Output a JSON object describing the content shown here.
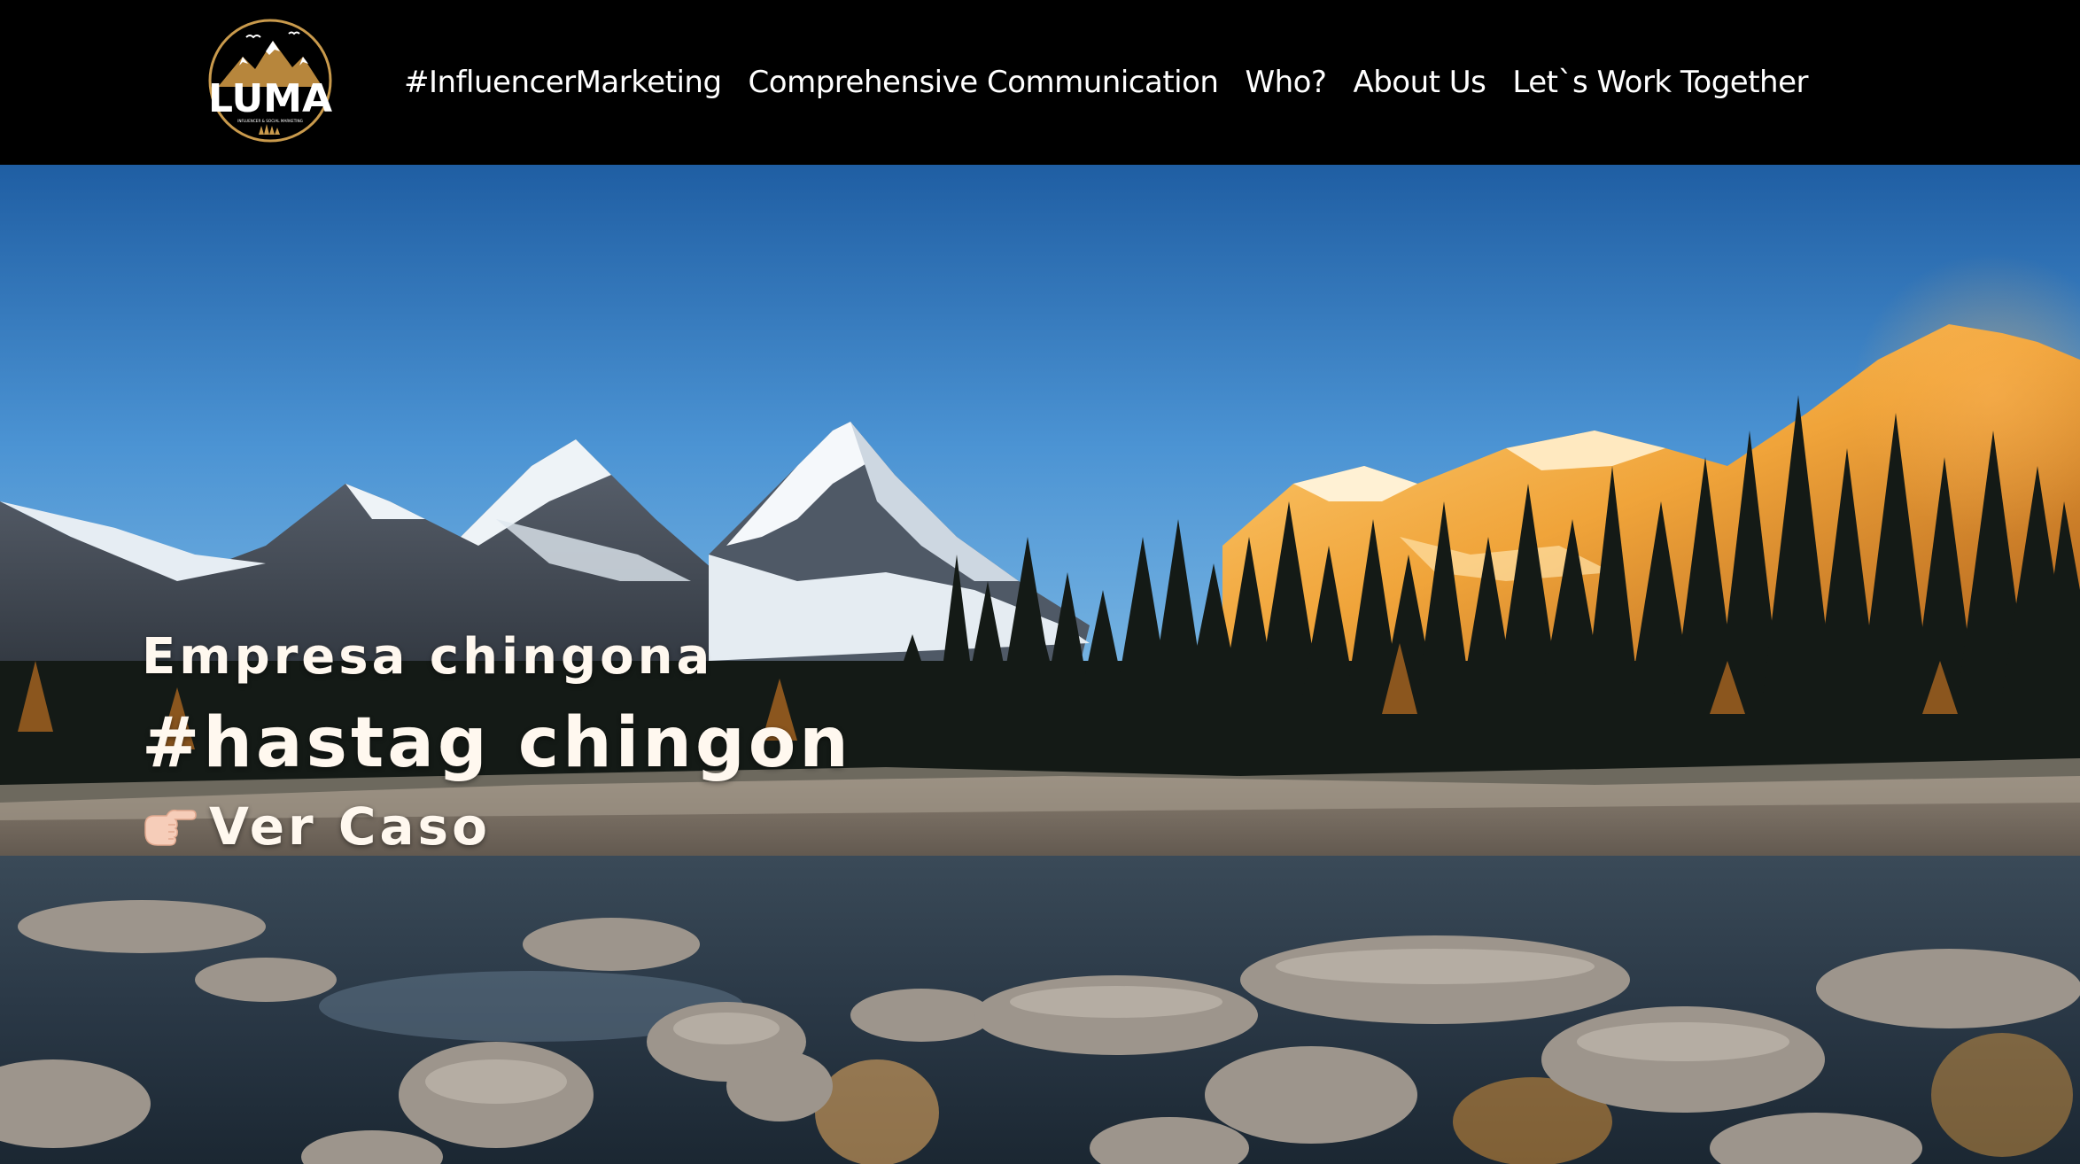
{
  "header": {
    "logo": {
      "text": "LUMA",
      "tagline": "INFLUENCER & SOCIAL MARKETING",
      "icon": "mountain-logo-icon"
    },
    "nav": [
      {
        "label": "#InfluencerMarketing"
      },
      {
        "label": "Comprehensive Communication"
      },
      {
        "label": "Who?"
      },
      {
        "label": "About Us"
      },
      {
        "label": "Let`s Work Together"
      }
    ]
  },
  "hero": {
    "kicker": "Empresa chingona",
    "title": "#hastag chingon",
    "cta": {
      "label": "Ver Caso",
      "icon": "pointing-hand-icon"
    },
    "background": "mountain-lake-photo"
  },
  "colors": {
    "header_bg": "#000000",
    "hero_text": "#fff8ef",
    "logo_gold": "#c99a4c",
    "sky_top": "#1f5ea3",
    "sky_bottom": "#74b6e6"
  }
}
